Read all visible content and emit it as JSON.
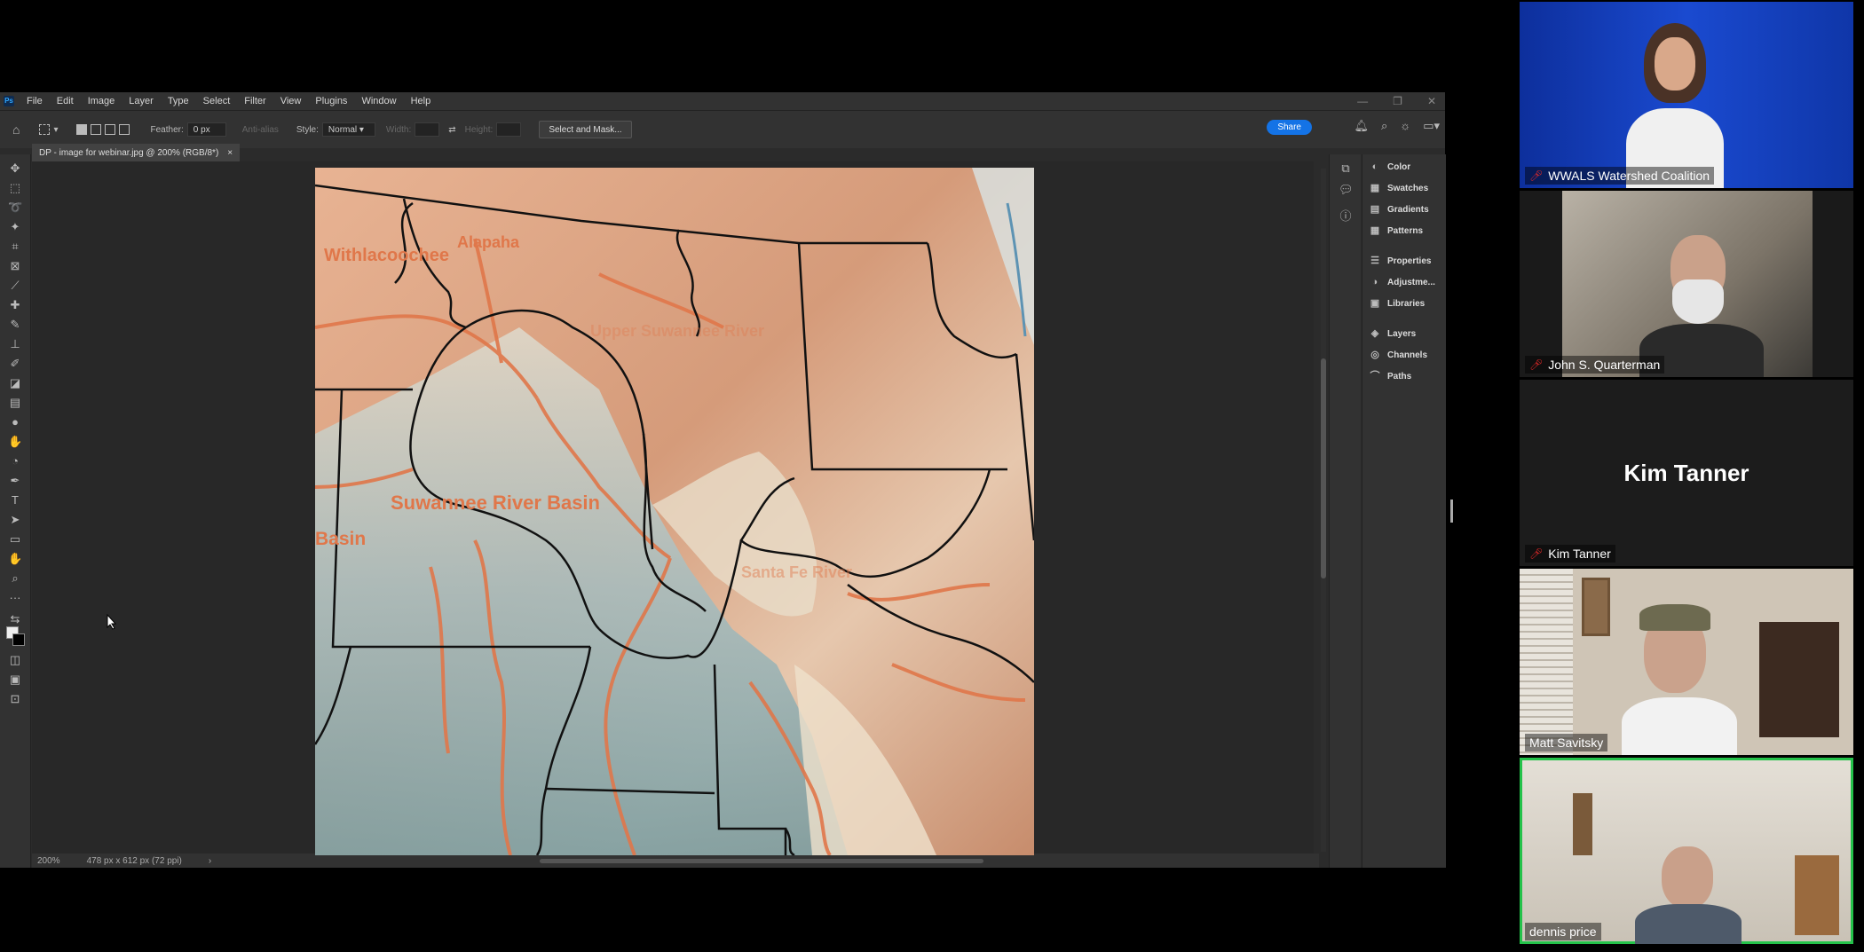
{
  "photoshop": {
    "menu": [
      "File",
      "Edit",
      "Image",
      "Layer",
      "Type",
      "Select",
      "Filter",
      "View",
      "Plugins",
      "Window",
      "Help"
    ],
    "window_controls": [
      "—",
      "❐",
      "✕"
    ],
    "options": {
      "feather_label": "Feather:",
      "feather_value": "0 px",
      "antialias_label": "Anti-alias",
      "style_label": "Style:",
      "style_value": "Normal",
      "width_label": "Width:",
      "height_label": "Height:",
      "select_mask_label": "Select and Mask...",
      "share_label": "Share"
    },
    "doc_tab": {
      "title": "DP - image for webinar.jpg @ 200% (RGB/8*)",
      "close": "×"
    },
    "status": {
      "zoom": "200%",
      "doc_info": "478 px x 612 px (72 ppi)"
    },
    "panels": [
      "Color",
      "Swatches",
      "Gradients",
      "Patterns",
      "Properties",
      "Adjustme...",
      "Libraries",
      "Layers",
      "Channels",
      "Paths"
    ]
  },
  "map": {
    "labels": {
      "withlacoochee": "Withlacoochee",
      "alapaha": "Alapaha",
      "suwannee": "Suwannee River Basin",
      "basin_left": "Basin",
      "upper": "Upper Suwannee River",
      "santa_fe": "Santa Fe River"
    }
  },
  "video": {
    "participants": [
      {
        "name": "WWALS Watershed Coalition",
        "muted": true
      },
      {
        "name": "John S. Quarterman",
        "muted": true
      },
      {
        "name": "Kim Tanner",
        "muted": true
      },
      {
        "name": "Matt Savitsky",
        "muted": false
      },
      {
        "name": "dennis price",
        "muted": false
      }
    ],
    "kim_display": "Kim Tanner"
  },
  "colors": {
    "accent": "#1473e6",
    "active_speaker": "#24c24a",
    "river": "#e0774a",
    "boundary": "#111111"
  }
}
